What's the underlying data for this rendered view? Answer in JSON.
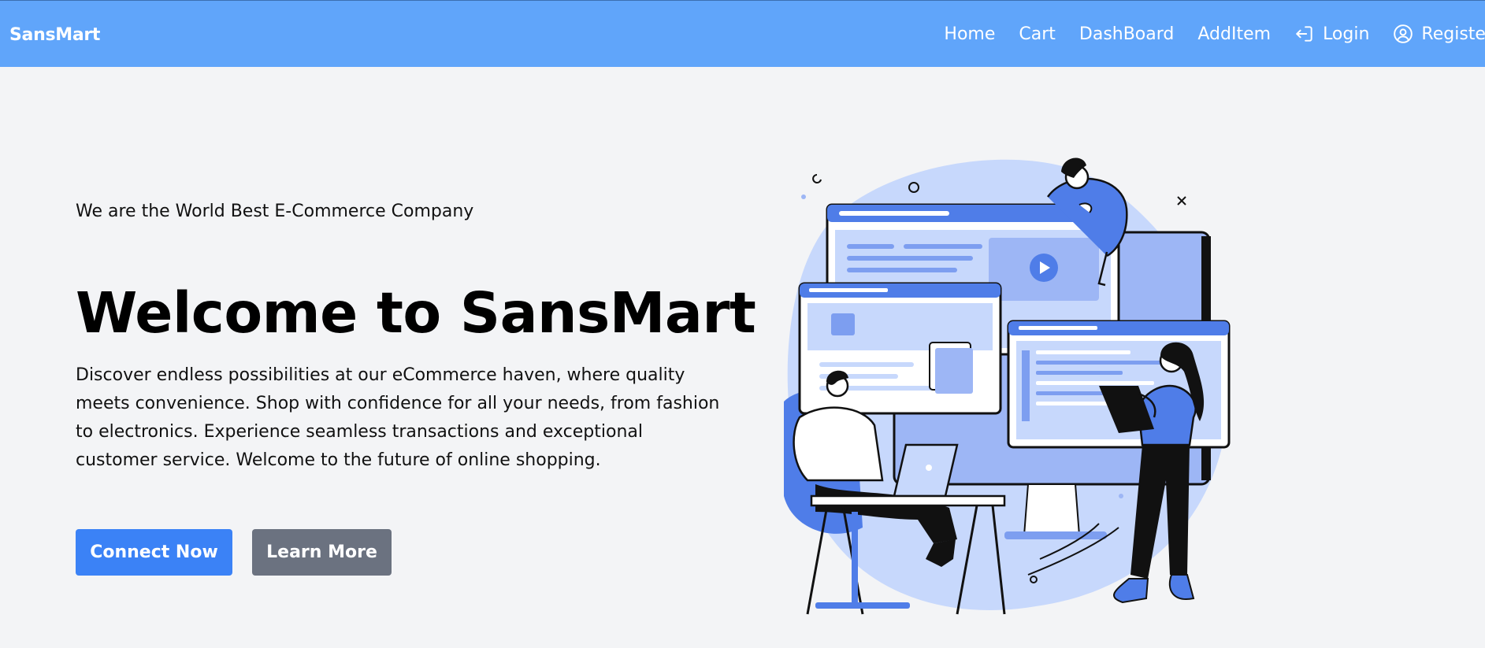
{
  "brand": "SansMart",
  "nav": {
    "items": [
      {
        "label": "Home",
        "icon": ""
      },
      {
        "label": "Cart",
        "icon": ""
      },
      {
        "label": "DashBoard",
        "icon": ""
      },
      {
        "label": "AddItem",
        "icon": ""
      },
      {
        "label": "Login",
        "icon": "login-icon"
      },
      {
        "label": "Register",
        "icon": "user-circle-icon"
      }
    ]
  },
  "hero": {
    "tagline": "We are the World Best E-Commerce Company",
    "headline": "Welcome to SansMart",
    "description": "Discover endless possibilities at our eCommerce haven, where quality meets convenience. Shop with confidence for all your needs, from fashion to electronics. Experience seamless transactions and exceptional customer service. Welcome to the future of online shopping.",
    "primary_button": "Connect Now",
    "secondary_button": "Learn More"
  },
  "colors": {
    "navbar": "#60a5fa",
    "page_background": "#f3f4f6",
    "primary_button": "#3b82f6",
    "secondary_button": "#6b7280",
    "illustration_accent": "#4f7de8"
  }
}
